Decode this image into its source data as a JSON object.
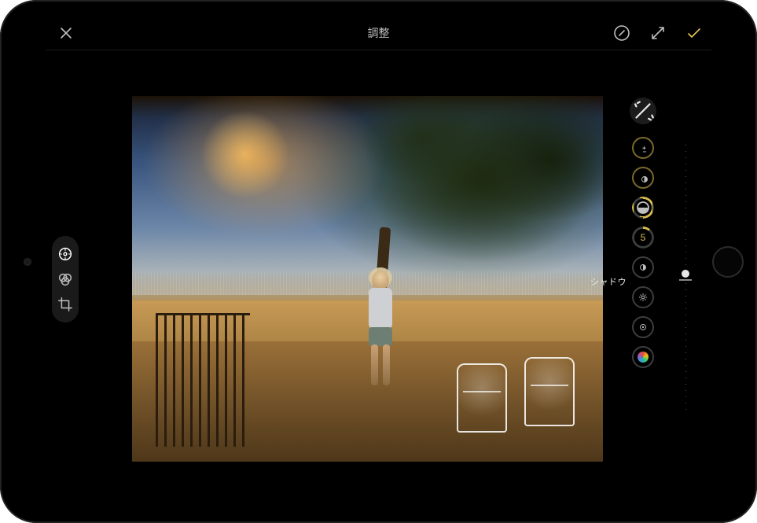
{
  "topbar": {
    "title": "調整"
  },
  "left_modes": [
    {
      "id": "adjust",
      "icon": "adjust-icon",
      "active": true
    },
    {
      "id": "filters",
      "icon": "filters-icon",
      "active": false
    },
    {
      "id": "crop",
      "icon": "crop-icon",
      "active": false
    }
  ],
  "adjust": {
    "selected_label": "シャドウ",
    "selected_value": "5",
    "dials": [
      {
        "id": "auto",
        "icon": "wand-icon"
      },
      {
        "id": "exposure",
        "icon": "exposure-plusminus-icon",
        "ring": "yellow"
      },
      {
        "id": "brilliance",
        "icon": "half-circle-icon",
        "ring": "yellow"
      },
      {
        "id": "highlights",
        "icon": "half-circle-alt-icon",
        "ring": "yellow-partial"
      },
      {
        "id": "shadows",
        "value": "5",
        "ring": "yellow-small",
        "selected": true
      },
      {
        "id": "contrast",
        "icon": "contrast-icon"
      },
      {
        "id": "brightness",
        "icon": "sun-icon"
      },
      {
        "id": "blackpoint",
        "icon": "dot-ring-icon"
      },
      {
        "id": "saturation",
        "icon": "rainbow-icon"
      }
    ]
  },
  "slider": {
    "min": -100,
    "max": 100,
    "value": 5
  },
  "colors": {
    "accent": "#d9be4e",
    "icon_muted": "#bfbfbf"
  }
}
